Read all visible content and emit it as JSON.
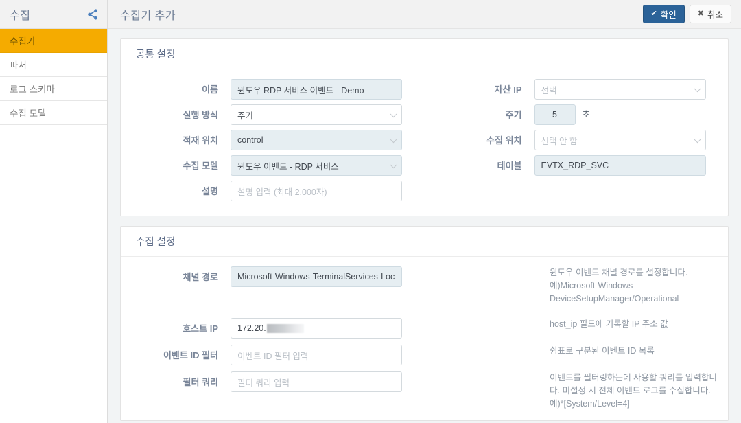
{
  "sidebar": {
    "title": "수집",
    "share_icon": "share-icon",
    "items": [
      {
        "label": "수집기",
        "active": true
      },
      {
        "label": "파서",
        "active": false
      },
      {
        "label": "로그 스키마",
        "active": false
      },
      {
        "label": "수집 모델",
        "active": false
      }
    ]
  },
  "topbar": {
    "page_title": "수집기 추가",
    "confirm_label": "확인",
    "confirm_icon": "check-icon",
    "cancel_label": "취소",
    "cancel_icon": "close-icon"
  },
  "common_section": {
    "heading": "공통 설정",
    "name": {
      "label": "이름",
      "value": "윈도우 RDP 서비스 이벤트 - Demo"
    },
    "run_mode": {
      "label": "실행 방식",
      "value": "주기"
    },
    "load_location": {
      "label": "적재 위치",
      "value": "control"
    },
    "collect_model": {
      "label": "수집 모델",
      "value": "윈도우 이벤트 - RDP 서비스"
    },
    "description": {
      "label": "설명",
      "value": "",
      "placeholder": "설명 입력 (최대 2,000자)"
    },
    "asset_ip": {
      "label": "자산 IP",
      "value": "",
      "placeholder": "선택"
    },
    "period": {
      "label": "주기",
      "value": "5",
      "unit": "초"
    },
    "collect_location": {
      "label": "수집 위치",
      "value": "",
      "placeholder": "선택 안 함"
    },
    "table": {
      "label": "테이블",
      "value": "EVTX_RDP_SVC"
    }
  },
  "collect_section": {
    "heading": "수집 설정",
    "channel_path": {
      "label": "채널 경로",
      "value": "Microsoft-Windows-TerminalServices-Local",
      "help": "윈도우 이벤트 채널 경로를 설정합니다. 예)Microsoft-Windows-DeviceSetupManager/Operational"
    },
    "host_ip": {
      "label": "호스트 IP",
      "value_prefix": "172.20.",
      "value_redacted": true,
      "help": "host_ip 필드에 기록할 IP 주소 값"
    },
    "event_id_filter": {
      "label": "이벤트 ID 필터",
      "value": "",
      "placeholder": "이벤트 ID 필터 입력",
      "help": "쉼표로 구분된 이벤트 ID 목록"
    },
    "filter_query": {
      "label": "필터 쿼리",
      "value": "",
      "placeholder": "필터 쿼리 입력",
      "help": "이벤트를 필터링하는데 사용할 쿼리를 입력합니다. 미설정 시 전체 이벤트 로그를 수집합니다. 예)*[System/Level=4]"
    }
  },
  "colors": {
    "accent_amber": "#f5ab00",
    "primary_blue": "#2b6298",
    "filled_field": "#e6eef2",
    "label_text": "#7a8699"
  }
}
